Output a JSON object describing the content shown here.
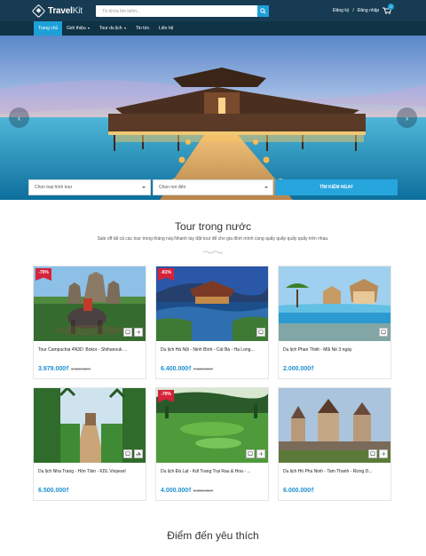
{
  "header": {
    "logo": {
      "bold": "Travel",
      "light": "Kit"
    },
    "search": {
      "placeholder": "Từ khóa tìm kiếm..."
    },
    "auth": {
      "register": "Đăng ký",
      "separator": "/",
      "login": "Đăng nhập"
    },
    "cart_count": "0"
  },
  "nav": {
    "items": [
      {
        "label": "Trang chủ",
        "active": true
      },
      {
        "label": "Giới thiệu",
        "dropdown": true
      },
      {
        "label": "Tour du lịch",
        "dropdown": true
      },
      {
        "label": "Tin tức"
      },
      {
        "label": "Liên hệ"
      }
    ]
  },
  "hero": {
    "prev_icon": "chevron-left-icon",
    "next_icon": "chevron-right-icon"
  },
  "filter": {
    "tour_type": "Chọn loại hình tour",
    "destination": "Chọn nơi đến",
    "button": "TÌM KIẾM NGAY"
  },
  "domestic": {
    "title": "Tour trong nước",
    "subtitle": "Sale off tất cả các tour trong tháng này.Nhanh tay đặt tour để cho gia đình mình cùng quẩy quẩy quẩy quẩy trên nhau.",
    "tours": [
      {
        "name": "Tour Campuchia 4N3D: Bokor - Shihanouk ...",
        "price": "3.979.000₫",
        "old_price": "4.990.000₫",
        "sale": "-70%"
      },
      {
        "name": "Du lịch Hà Nội - Ninh Bình - Cát Bà - Hạ Long...",
        "price": "6.400.000₫",
        "old_price": "7.900.000₫",
        "sale": "-81%"
      },
      {
        "name": "Du lịch Phan Thiết - Mũi Né 3 ngày",
        "price": "2.000.000₫",
        "old_price": "",
        "sale": ""
      },
      {
        "name": "Du lịch Nha Trang - Hòn Tằm - KDL Vinpearl",
        "price": "6.500.000₫",
        "old_price": "",
        "sale": ""
      },
      {
        "name": "Du lịch Đà Lạt - Kdl Trang Trại Rau & Hoa - ...",
        "price": "4.000.000₫",
        "old_price": "5.000.000₫",
        "sale": "-70%"
      },
      {
        "name": "Du lịch Hồ Phú Ninh - Tam Thanh - Rừng D...",
        "price": "6.000.000₫",
        "old_price": "",
        "sale": ""
      }
    ]
  },
  "featured": {
    "title": "Điểm đến yêu thích"
  },
  "colors": {
    "header": "#173b52",
    "nav": "#0f3245",
    "accent": "#1da0d8",
    "sale": "#d6223a",
    "price": "#1f8fd1"
  }
}
